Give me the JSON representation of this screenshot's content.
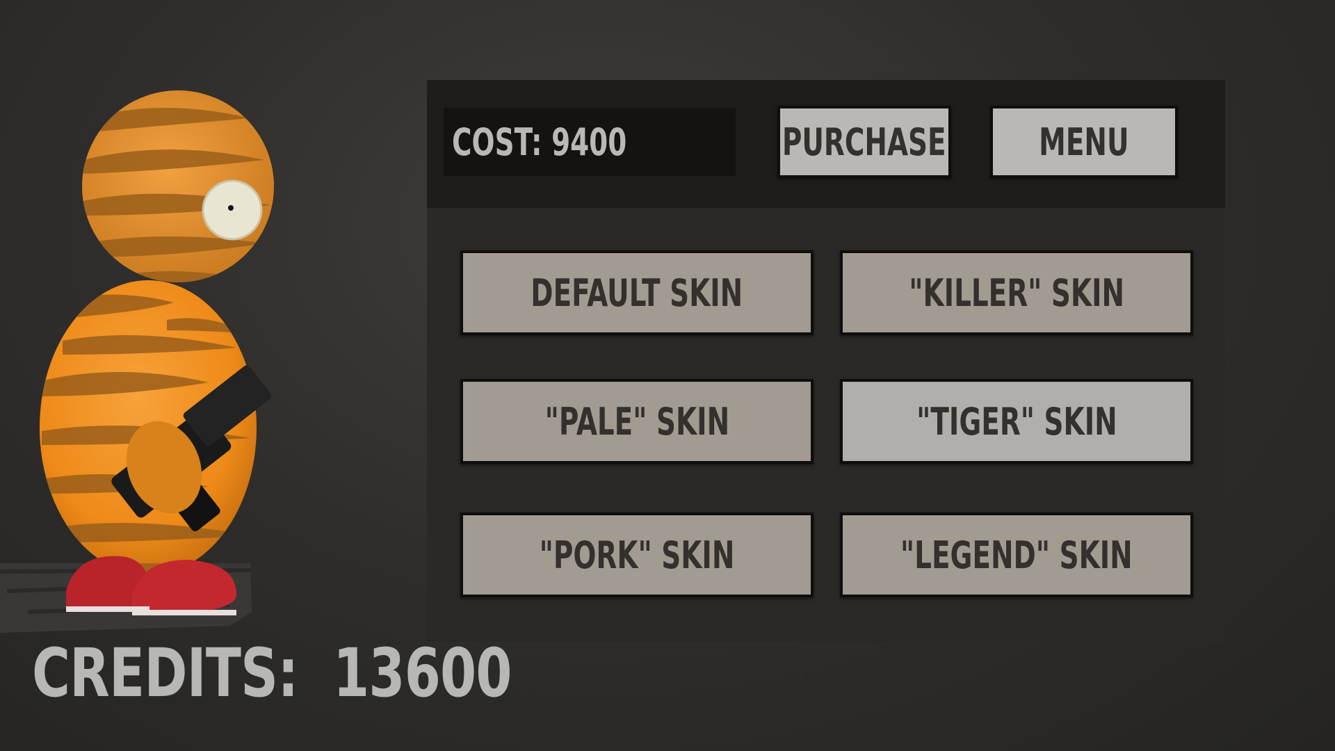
{
  "player": {
    "credits_label": "CREDITS:",
    "credits_value": "13600",
    "skin_colors": {
      "body": "#f08a1a",
      "stripes": "#a9661a",
      "shoes": "#b8242a",
      "weapon": "#1a1a1a"
    }
  },
  "shop": {
    "cost_label": "COST: 9400",
    "purchase_label": "PURCHASE",
    "menu_label": "MENU",
    "skins": [
      {
        "label": "DEFAULT SKIN"
      },
      {
        "label": "\"KILLER\" SKIN"
      },
      {
        "label": "\"PALE\" SKIN"
      },
      {
        "label": "\"TIGER\" SKIN"
      },
      {
        "label": "\"PORK\" SKIN"
      },
      {
        "label": "\"LEGEND\" SKIN"
      }
    ]
  }
}
